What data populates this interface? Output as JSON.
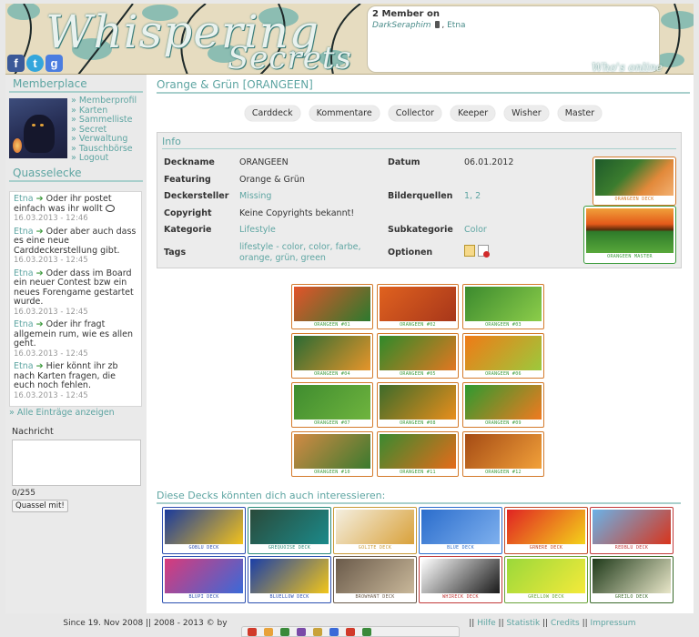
{
  "header": {
    "logo_line1": "Whispering",
    "logo_line2": "Secrets",
    "online_title": "2 Member on",
    "online_user1": "DarkSeraphim",
    "online_sep": ", ",
    "online_user2": "Etna",
    "whos_online": "Who's online"
  },
  "social": [
    "f",
    "t",
    "g"
  ],
  "sidebar": {
    "memberplace": "Memberplace",
    "links": [
      "Memberprofil",
      "Karten",
      "Sammelliste",
      "Secret",
      "Verwaltung",
      "Tauschbörse",
      "Logout"
    ],
    "quasselecke": "Quasselecke",
    "shouts": [
      {
        "user": "Etna",
        "text": "Oder ihr postet einfach was ihr wollt",
        "date": "16.03.2013 - 12:46"
      },
      {
        "user": "Etna",
        "text": "Oder aber auch dass es eine neue Carddeckerstellung gibt.",
        "date": "16.03.2013 - 12:45"
      },
      {
        "user": "Etna",
        "text": "Oder dass im Board ein neuer Contest bzw ein neues Forengame gestartet wurde.",
        "date": "16.03.2013 - 12:45"
      },
      {
        "user": "Etna",
        "text": "Oder ihr fragt allgemein rum, wie es allen geht.",
        "date": "16.03.2013 - 12:45"
      },
      {
        "user": "Etna",
        "text": "Hier könnt ihr zb nach Karten fragen, die euch noch fehlen.",
        "date": "16.03.2013 - 12:45"
      }
    ],
    "all_entries": "Alle Einträge anzeigen",
    "message_label": "Nachricht",
    "counter": "0/255",
    "send_button": "Quassel mit!"
  },
  "main": {
    "title": "Orange & Grün [ORANGEEN]",
    "tabs": [
      "Carddeck",
      "Kommentare",
      "Collector",
      "Keeper",
      "Wisher",
      "Master"
    ],
    "info_heading": "Info",
    "info": {
      "deckname_k": "Deckname",
      "deckname_v": "ORANGEEN",
      "featuring_k": "Featuring",
      "featuring_v": "Orange & Grün",
      "deckersteller_k": "Deckersteller",
      "deckersteller_v": "Missing",
      "copyright_k": "Copyright",
      "copyright_v": "Keine Copyrights bekannt!",
      "kategorie_k": "Kategorie",
      "kategorie_v": "Lifestyle",
      "tags_k": "Tags",
      "tags_line1": "lifestyle - color, color, farbe,",
      "tags_line2": "orange, grün, green",
      "datum_k": "Datum",
      "datum_v": "06.01.2012",
      "bilderquellen_k": "Bilderquellen",
      "bilderquellen_v": "1, 2",
      "subkategorie_k": "Subkategorie",
      "subkategorie_v": "Color",
      "optionen_k": "Optionen"
    },
    "deck_card_caption": "ORANGEEN DECK",
    "master_card_caption": "ORANGEEN MASTER",
    "cards": [
      {
        "caption": "ORANGEEN #01",
        "c1": "#e4532a",
        "c2": "#2c7a2e"
      },
      {
        "caption": "ORANGEEN #02",
        "c1": "#e0621f",
        "c2": "#a7361a"
      },
      {
        "caption": "ORANGEEN #03",
        "c1": "#3b8a2e",
        "c2": "#8ccd4a"
      },
      {
        "caption": "ORANGEEN #04",
        "c1": "#2a6a33",
        "c2": "#e6952a"
      },
      {
        "caption": "ORANGEEN #05",
        "c1": "#2f8a2a",
        "c2": "#e27721"
      },
      {
        "caption": "ORANGEEN #06",
        "c1": "#f07a16",
        "c2": "#9cc93c"
      },
      {
        "caption": "ORANGEEN #07",
        "c1": "#3f8c2f",
        "c2": "#6fb43e"
      },
      {
        "caption": "ORANGEEN #08",
        "c1": "#3d6b2a",
        "c2": "#e88e1c"
      },
      {
        "caption": "ORANGEEN #09",
        "c1": "#2e9a30",
        "c2": "#f07a20"
      },
      {
        "caption": "ORANGEEN #10",
        "c1": "#d38a45",
        "c2": "#3a7a2e"
      },
      {
        "caption": "ORANGEEN #11",
        "c1": "#3a8a30",
        "c2": "#e56b1a"
      },
      {
        "caption": "ORANGEEN #12",
        "c1": "#a44a14",
        "c2": "#f2a13a"
      }
    ],
    "suggest_heading": "Diese Decks könnten dich auch interessieren:",
    "suggestions": [
      {
        "caption": "GOBLU DECK",
        "c1": "#1a3a9c",
        "c2": "#f2c21c",
        "border": "#2c4db0"
      },
      {
        "caption": "GREQUOISE DECK",
        "c1": "#2a4a3a",
        "c2": "#1b8a8a",
        "border": "#2a8a7a"
      },
      {
        "caption": "GOLITE DECK",
        "c1": "#f4efe0",
        "c2": "#d9a13a",
        "border": "#c99a36"
      },
      {
        "caption": "BLUE DECK",
        "c1": "#2b6dcc",
        "c2": "#7eb0ee",
        "border": "#2b6dcc"
      },
      {
        "caption": "GRNERE DECK",
        "c1": "#e02323",
        "c2": "#f4d21a",
        "border": "#c24a2a"
      },
      {
        "caption": "REDBLU DECK",
        "c1": "#6ab2e8",
        "c2": "#d8351c",
        "border": "#c23a3a"
      },
      {
        "caption": "BLUPI DECK",
        "c1": "#d93a7a",
        "c2": "#3a6ad8",
        "border": "#2b4fb0"
      },
      {
        "caption": "BLUELLOW DECK",
        "c1": "#1a3ea8",
        "c2": "#f2c61a",
        "border": "#2b4fb0"
      },
      {
        "caption": "BROWHANT DECK",
        "c1": "#6a5a4a",
        "c2": "#c9b89a",
        "border": "#6a5a4a"
      },
      {
        "caption": "WHIRECK DECK",
        "c1": "#ffffff",
        "c2": "#1a1a1a",
        "border": "#c23a3a"
      },
      {
        "caption": "GRELLOW DECK",
        "c1": "#9ad83a",
        "c2": "#f4ea3a",
        "border": "#6aa43a"
      },
      {
        "caption": "GREILO DECK",
        "c1": "#1f3a1a",
        "c2": "#e8e6c8",
        "border": "#3a6a2a"
      }
    ]
  },
  "footer": {
    "text_start": "Since 19. Nov 2008 || 2008 - 2013 © by",
    "links": [
      "Hilfe",
      "Statistik",
      "Credits",
      "Impressum"
    ]
  }
}
